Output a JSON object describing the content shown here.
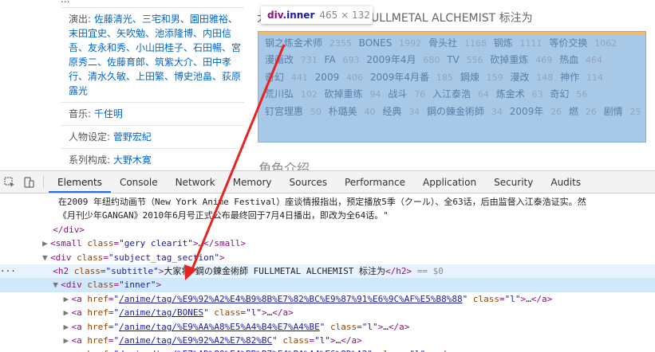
{
  "page": {
    "truncated_text": "...",
    "staff": [
      {
        "label": "演出: ",
        "value": "佐藤清光、三宅和男、園田雅裕、末田宜史、矢吹勉、池添隆博、内田信吾、友永和秀、小山田桂子、石田暢、宮原秀二、佐藤育郎、筑紫大介、田中孝行、清水久敏、上田繁、博史池畠、荻原露光"
      },
      {
        "label": "音乐: ",
        "value": "千住明"
      },
      {
        "label": "人物设定: ",
        "value": "菅野宏紀"
      },
      {
        "label": "系列构成: ",
        "value": "大野木寛"
      }
    ],
    "tags_title": "大家将 鋼の錬金術師 FULLMETAL ALCHEMIST 标注为",
    "tags": [
      {
        "name": "钢之炼金术师",
        "count": "2355"
      },
      {
        "name": "BONES",
        "count": "1992"
      },
      {
        "name": "骨头社",
        "count": "1168"
      },
      {
        "name": "钢炼",
        "count": "1111"
      },
      {
        "name": "等价交换",
        "count": "1062"
      },
      {
        "name": "漫画改",
        "count": "731"
      },
      {
        "name": "FA",
        "count": "693"
      },
      {
        "name": "2009年4月",
        "count": "680"
      },
      {
        "name": "TV",
        "count": "556"
      },
      {
        "name": "砍掉重炼",
        "count": "469"
      },
      {
        "name": "热血",
        "count": "464"
      },
      {
        "name": "奇幻",
        "count": "441"
      },
      {
        "name": "2009",
        "count": "406"
      },
      {
        "name": "2009年4月番",
        "count": "185"
      },
      {
        "name": "鋼煉",
        "count": "159"
      },
      {
        "name": "漫改",
        "count": "148"
      },
      {
        "name": "神作",
        "count": "114"
      },
      {
        "name": "荒川弘",
        "count": "102"
      },
      {
        "name": "砍掉重练",
        "count": "94"
      },
      {
        "name": "战斗",
        "count": "76"
      },
      {
        "name": "入江泰浩",
        "count": "64"
      },
      {
        "name": "炼金术",
        "count": "63"
      },
      {
        "name": "奇幻",
        "count": "56"
      },
      {
        "name": "钉宫理惠",
        "count": "50"
      },
      {
        "name": "朴璐美",
        "count": "40"
      },
      {
        "name": "经典",
        "count": "34"
      },
      {
        "name": "鋼の錬金術師",
        "count": "34"
      },
      {
        "name": "2009年",
        "count": "26"
      },
      {
        "name": "燃",
        "count": "26"
      },
      {
        "name": "剧情",
        "count": "25"
      }
    ],
    "character_heading": "角色介绍"
  },
  "tooltip": {
    "tag": "div",
    "cls": ".inner",
    "dims": "465 × 132"
  },
  "devtools": {
    "tabs": [
      "Elements",
      "Console",
      "Network",
      "Memory",
      "Sources",
      "Performance",
      "Application",
      "Security",
      "Audits"
    ],
    "active_tab": "Elements",
    "text_line1": "在2009 年纽约动画节（New York Anime Festival）座谈情报指出，预定播放5季（クール）、全63话，后由监督入江泰浩证实。然",
    "text_line2": "《月刊少年GANGAN》2010年6月号正式公布最终回于7月4日播出，即改为全64话。\"",
    "close_div": "</div>",
    "small_tag": "small",
    "small_class": "gery clearit",
    "div_tag": "div",
    "div_class": "subject_tag_section",
    "h2_tag": "h2",
    "h2_class": "subtitle",
    "h2_text": "大家将 鋼の錬金術師 FULLMETAL ALCHEMIST 标注为",
    "dollar_zero": "== $0",
    "inner_tag": "div",
    "inner_class": "inner",
    "link_class": "l",
    "links": [
      "/anime/tag/%E9%92%A2%E4%B9%8B%E7%82%BC%E9%87%91%E6%9C%AF%E5%B8%88",
      "/anime/tag/BONES",
      "/anime/tag/%E9%AA%A8%E5%A4%B4%E7%A4%BE",
      "/anime/tag/%E9%92%A2%E7%82%BC",
      "/anime/tag/%E7%AD%89%E4%BB%B7%E4%BA%A4%E6%8D%A2"
    ]
  },
  "colors": {
    "annotation_arrow": "#e8231f",
    "highlight": "#a8c8e8",
    "active_tab": "#1a73e8"
  }
}
